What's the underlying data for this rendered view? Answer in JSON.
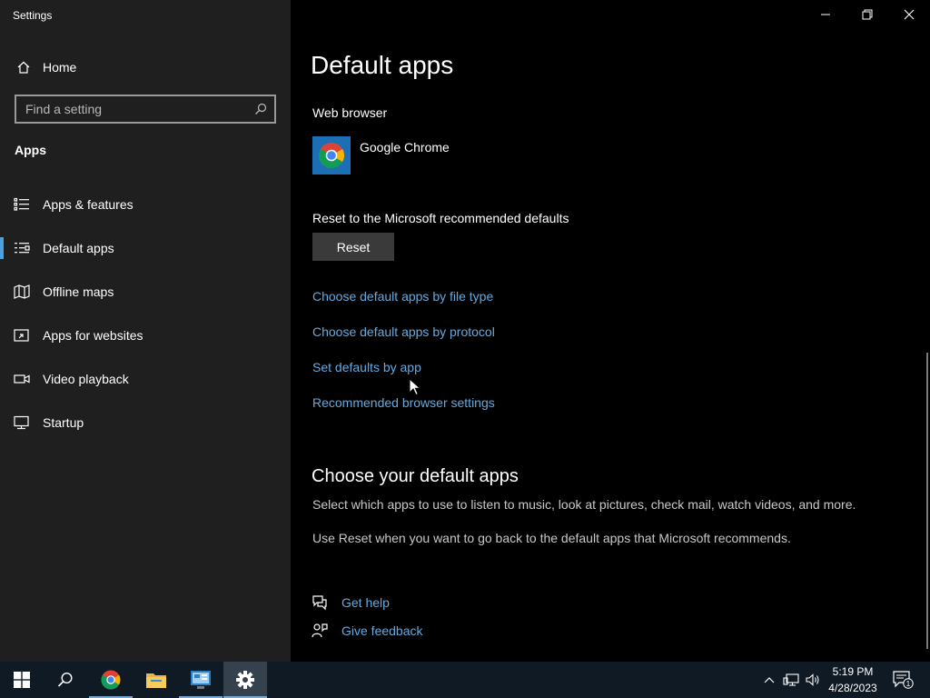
{
  "window": {
    "title": "Settings"
  },
  "sidebar": {
    "home_label": "Home",
    "search_placeholder": "Find a setting",
    "section_title": "Apps",
    "items": [
      {
        "label": "Apps & features",
        "icon": "list-icon"
      },
      {
        "label": "Default apps",
        "icon": "default-apps-icon",
        "selected": true
      },
      {
        "label": "Offline maps",
        "icon": "map-icon"
      },
      {
        "label": "Apps for websites",
        "icon": "link-window-icon"
      },
      {
        "label": "Video playback",
        "icon": "video-icon"
      },
      {
        "label": "Startup",
        "icon": "startup-icon"
      }
    ]
  },
  "main": {
    "title": "Default apps",
    "web_browser_label": "Web browser",
    "web_browser_app": "Google Chrome",
    "reset_label": "Reset to the Microsoft recommended defaults",
    "reset_button": "Reset",
    "links": [
      "Choose default apps by file type",
      "Choose default apps by protocol",
      "Set defaults by app",
      "Recommended browser settings"
    ],
    "section_heading": "Choose your default apps",
    "desc1": "Select which apps to use to listen to music, look at pictures, check mail, watch videos, and more.",
    "desc2": "Use Reset when you want to go back to the default apps that Microsoft recommends.",
    "get_help": "Get help",
    "give_feedback": "Give feedback"
  },
  "taskbar": {
    "apps": [
      "start-icon",
      "search-icon",
      "chrome-icon",
      "file-explorer-icon",
      "control-panel-icon",
      "settings-gear-icon"
    ],
    "time": "5:19 PM",
    "date": "4/28/2023",
    "notification_count": "1"
  },
  "colors": {
    "accent": "#4aa3df",
    "link": "#65a9de",
    "sidebar_bg": "#1f1f1f",
    "main_bg": "#000000",
    "taskbar_bg": "#0f1a24"
  }
}
